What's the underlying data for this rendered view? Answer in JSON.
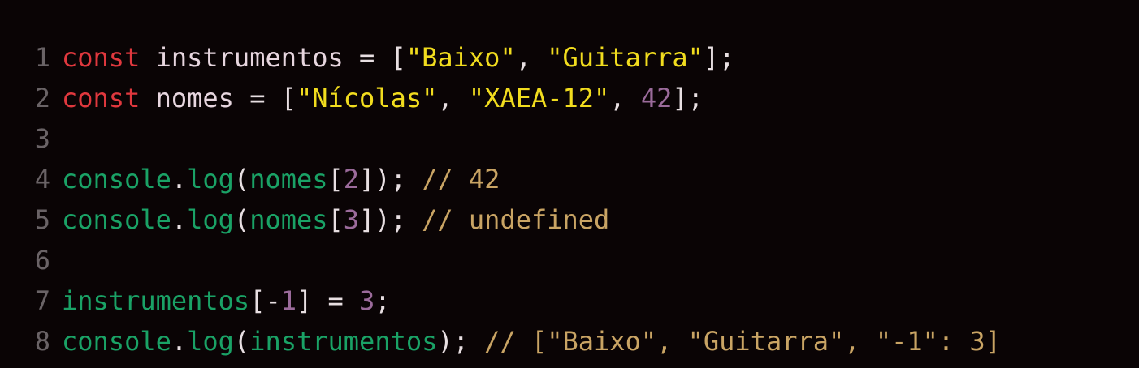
{
  "editor": {
    "lines": [
      {
        "number": "1",
        "tokens": [
          {
            "text": "const",
            "type": "kw"
          },
          {
            "text": " ",
            "type": "op"
          },
          {
            "text": "instrumentos",
            "type": "var"
          },
          {
            "text": " = [",
            "type": "op"
          },
          {
            "text": "\"Baixo\"",
            "type": "str"
          },
          {
            "text": ", ",
            "type": "op"
          },
          {
            "text": "\"Guitarra\"",
            "type": "str"
          },
          {
            "text": "];",
            "type": "op"
          }
        ]
      },
      {
        "number": "2",
        "tokens": [
          {
            "text": "const",
            "type": "kw"
          },
          {
            "text": " ",
            "type": "op"
          },
          {
            "text": "nomes",
            "type": "var"
          },
          {
            "text": " = [",
            "type": "op"
          },
          {
            "text": "\"Nícolas\"",
            "type": "str"
          },
          {
            "text": ", ",
            "type": "op"
          },
          {
            "text": "\"XAEA-12\"",
            "type": "str"
          },
          {
            "text": ", ",
            "type": "op"
          },
          {
            "text": "42",
            "type": "num"
          },
          {
            "text": "];",
            "type": "op"
          }
        ]
      },
      {
        "number": "3",
        "tokens": []
      },
      {
        "number": "4",
        "tokens": [
          {
            "text": "console",
            "type": "fn"
          },
          {
            "text": ".",
            "type": "op"
          },
          {
            "text": "log",
            "type": "fn"
          },
          {
            "text": "(",
            "type": "op"
          },
          {
            "text": "nomes",
            "type": "fn"
          },
          {
            "text": "[",
            "type": "op"
          },
          {
            "text": "2",
            "type": "num"
          },
          {
            "text": "]); ",
            "type": "op"
          },
          {
            "text": "// 42",
            "type": "cmt"
          }
        ]
      },
      {
        "number": "5",
        "tokens": [
          {
            "text": "console",
            "type": "fn"
          },
          {
            "text": ".",
            "type": "op"
          },
          {
            "text": "log",
            "type": "fn"
          },
          {
            "text": "(",
            "type": "op"
          },
          {
            "text": "nomes",
            "type": "fn"
          },
          {
            "text": "[",
            "type": "op"
          },
          {
            "text": "3",
            "type": "num"
          },
          {
            "text": "]); ",
            "type": "op"
          },
          {
            "text": "// undefined",
            "type": "cmt"
          }
        ]
      },
      {
        "number": "6",
        "tokens": []
      },
      {
        "number": "7",
        "tokens": [
          {
            "text": "instrumentos",
            "type": "fn"
          },
          {
            "text": "[-",
            "type": "op"
          },
          {
            "text": "1",
            "type": "num"
          },
          {
            "text": "] = ",
            "type": "op"
          },
          {
            "text": "3",
            "type": "num"
          },
          {
            "text": ";",
            "type": "op"
          }
        ]
      },
      {
        "number": "8",
        "tokens": [
          {
            "text": "console",
            "type": "fn"
          },
          {
            "text": ".",
            "type": "op"
          },
          {
            "text": "log",
            "type": "fn"
          },
          {
            "text": "(",
            "type": "op"
          },
          {
            "text": "instrumentos",
            "type": "fn"
          },
          {
            "text": "); ",
            "type": "op"
          },
          {
            "text": "// [\"Baixo\", \"Guitarra\", \"-1\": 3]",
            "type": "cmt"
          }
        ]
      }
    ]
  },
  "colors": {
    "background": "#0a0405",
    "line_number": "#6a6366",
    "keyword": "#e0383e",
    "variable": "#e7d6df",
    "string": "#f1dc1e",
    "number": "#9b6b9b",
    "function": "#1aa266",
    "comment": "#c9a464"
  }
}
